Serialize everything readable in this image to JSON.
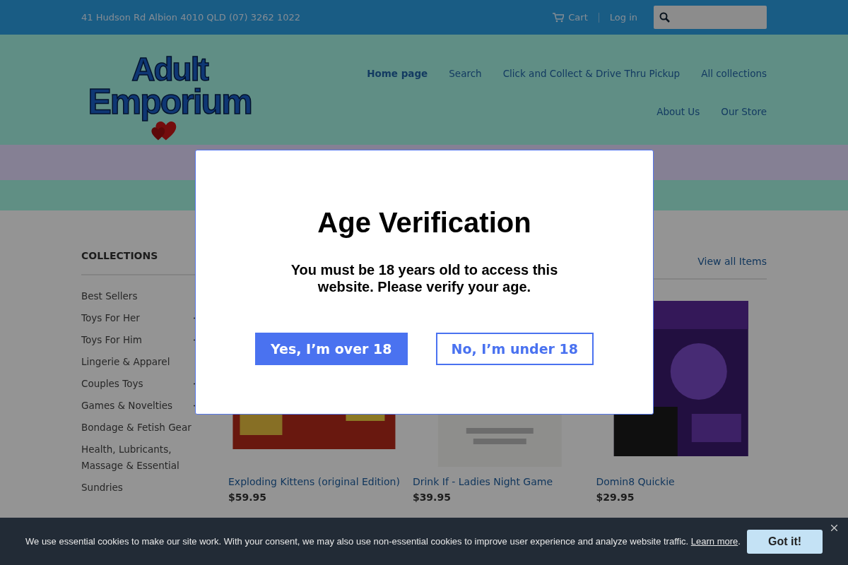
{
  "top_bar": {
    "address": "41 Hudson Rd Albion 4010 QLD (07) 3262 1022",
    "cart": "Cart",
    "login": "Log in"
  },
  "logo": {
    "line_1": "Adult",
    "line_2": "Emporium"
  },
  "nav": [
    {
      "label": "Home page",
      "selected": true
    },
    {
      "label": "Search",
      "selected": false
    },
    {
      "label": "Click and Collect & Drive Thru Pickup",
      "selected": false
    },
    {
      "label": "All collections",
      "selected": false
    },
    {
      "label": "About Us",
      "selected": false
    },
    {
      "label": "Our Store",
      "selected": false
    }
  ],
  "sidebar": {
    "title": "COLLECTIONS",
    "items": [
      {
        "label": "Best Sellers",
        "expandable": false
      },
      {
        "label": "Toys For Her",
        "expandable": true
      },
      {
        "label": "Toys For Him",
        "expandable": true
      },
      {
        "label": "Lingerie & Apparel",
        "expandable": false
      },
      {
        "label": "Couples Toys",
        "expandable": true
      },
      {
        "label": "Games & Novelties",
        "expandable": true
      },
      {
        "label": "Bondage & Fetish Gear",
        "expandable": false
      },
      {
        "label": "Health, Lubricants, Massage & Essential",
        "expandable": false
      },
      {
        "label": "Sundries",
        "expandable": false
      }
    ]
  },
  "section": {
    "link": "View all Items"
  },
  "products": [
    {
      "title": "Exploding Kittens (original Edition)",
      "price": "$59.95",
      "kind": "picture"
    },
    {
      "title": "Drink If - Ladies Night Game",
      "price": "$39.95",
      "kind": "picture"
    },
    {
      "title": "Domin8 Quickie",
      "price": "$29.95",
      "kind": "picture"
    }
  ],
  "age_modal": {
    "title": "Age Verification",
    "message": "You must be 18 years old to access this website. Please verify your age.",
    "accept": "Yes, I’m over 18",
    "decline": "No, I’m under 18"
  },
  "cookie_banner": {
    "text": "We use essential cookies to make our site work. With your consent, we may also use non-essential cookies to improve user experience and analyze website traffic.",
    "link": "Learn more",
    "end": ".",
    "button": "Got it!"
  }
}
